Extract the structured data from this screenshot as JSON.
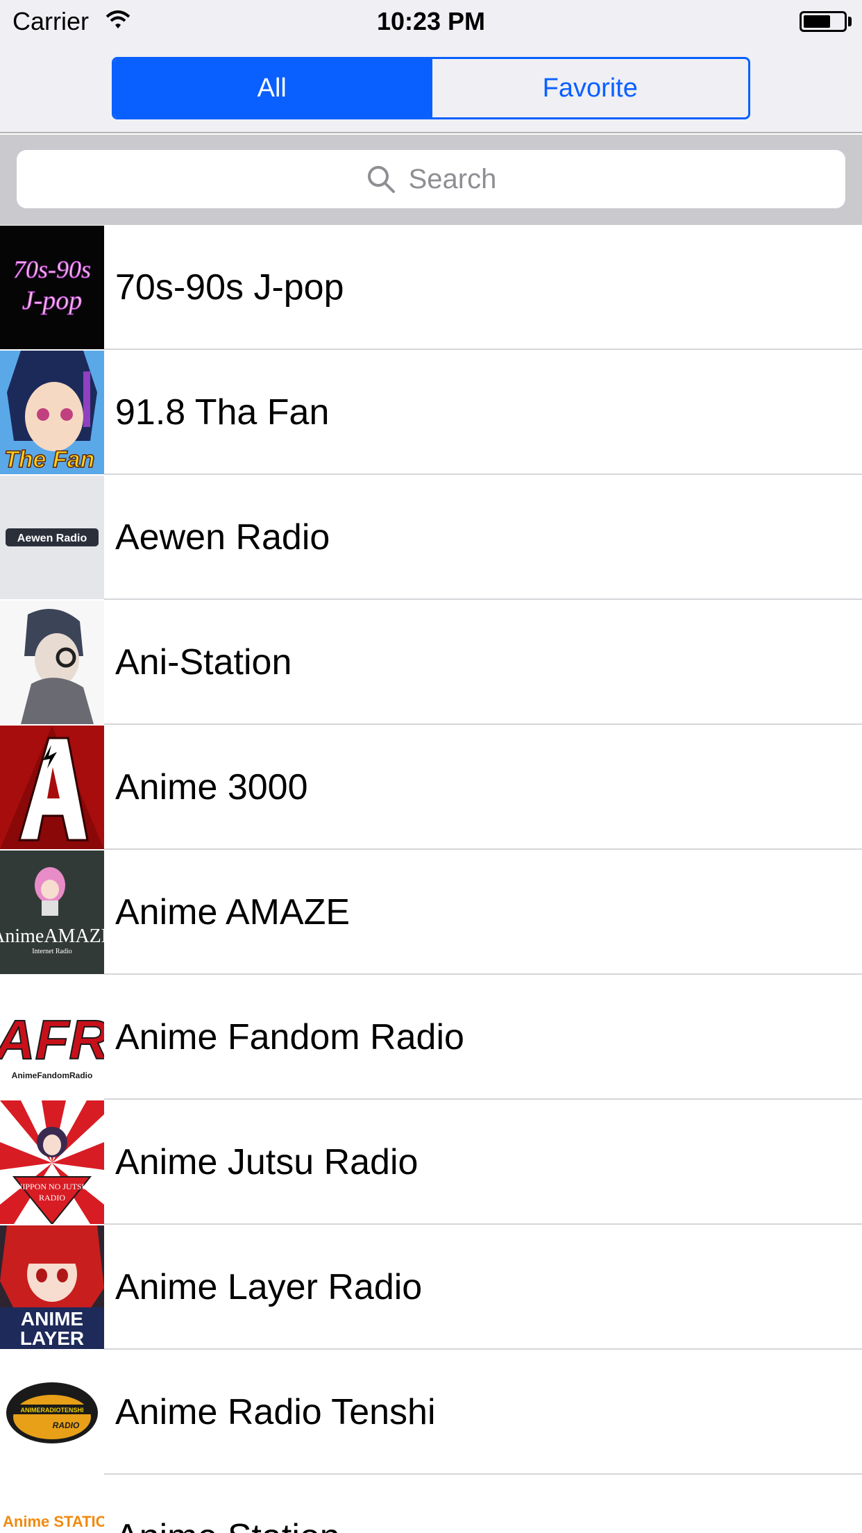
{
  "status_bar": {
    "carrier": "Carrier",
    "time": "10:23 PM",
    "wifi_icon": "wifi-icon",
    "battery_icon": "battery-icon"
  },
  "segmented": {
    "all_label": "All",
    "favorite_label": "Favorite",
    "selected": "All",
    "accent_color": "#0a60ff"
  },
  "search": {
    "placeholder": "Search",
    "icon": "search-icon"
  },
  "stations": [
    {
      "name": "70s-90s J-pop"
    },
    {
      "name": "91.8 Tha Fan"
    },
    {
      "name": "Aewen Radio"
    },
    {
      "name": "Ani-Station"
    },
    {
      "name": "Anime 3000"
    },
    {
      "name": "Anime AMAZE"
    },
    {
      "name": "Anime Fandom Radio"
    },
    {
      "name": "Anime Jutsu Radio"
    },
    {
      "name": "Anime Layer Radio"
    },
    {
      "name": "Anime Radio Tenshi"
    },
    {
      "name": "Anime Station"
    }
  ],
  "thumb_text": {
    "t0": "70s-90s",
    "t0b": "J-pop",
    "t1": "The Fan",
    "t2": "Aewen Radio",
    "t5": "AnimeAMAZE",
    "t5b": "Internet Radio",
    "t6": "AFR",
    "t6b": "AnimeFandomRadio",
    "t7": "NIPPON NO JUTSU",
    "t7b": "RADIO",
    "t8": "ANIME",
    "t8b": "LAYER",
    "t9": "ANIMERADIOTENSHI",
    "t9b": "RADIO",
    "t10": "Anime STATION"
  }
}
